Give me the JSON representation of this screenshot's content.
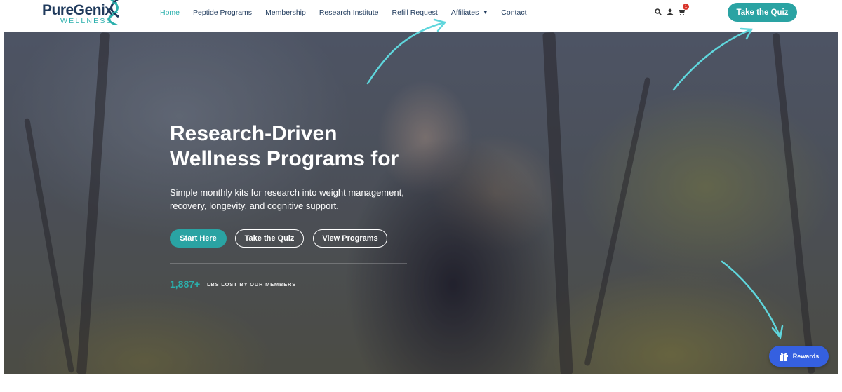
{
  "brand": {
    "name": "PureGenix",
    "tagline": "WELLNESS",
    "teal": "#2aa3a3",
    "navy": "#1f3a5c"
  },
  "nav": {
    "items": [
      {
        "label": "Home",
        "active": true
      },
      {
        "label": "Peptide Programs"
      },
      {
        "label": "Membership"
      },
      {
        "label": "Research Institute"
      },
      {
        "label": "Refill Request"
      },
      {
        "label": "Affiliates",
        "has_dropdown": true
      },
      {
        "label": "Contact"
      }
    ]
  },
  "header_icons": {
    "search": "search-icon",
    "account": "user-icon",
    "cart": "cart-icon",
    "cart_count": "1"
  },
  "header_cta": {
    "label": "Take the Quiz"
  },
  "hero": {
    "title": "Research-Driven\nWellness Programs for",
    "subtitle": "Simple monthly kits for research into weight management,\nrecovery, longevity, and cognitive support.",
    "buttons": {
      "start": "Start Here",
      "quiz": "Take the Quiz",
      "programs": "View Programs"
    },
    "stat": {
      "value": "1,887+",
      "label": "LBS LOST BY OUR MEMBERS"
    }
  },
  "rewards": {
    "label": "Rewards",
    "color": "#3560e0"
  },
  "annotation_arrow_color": "#5fd6dc"
}
